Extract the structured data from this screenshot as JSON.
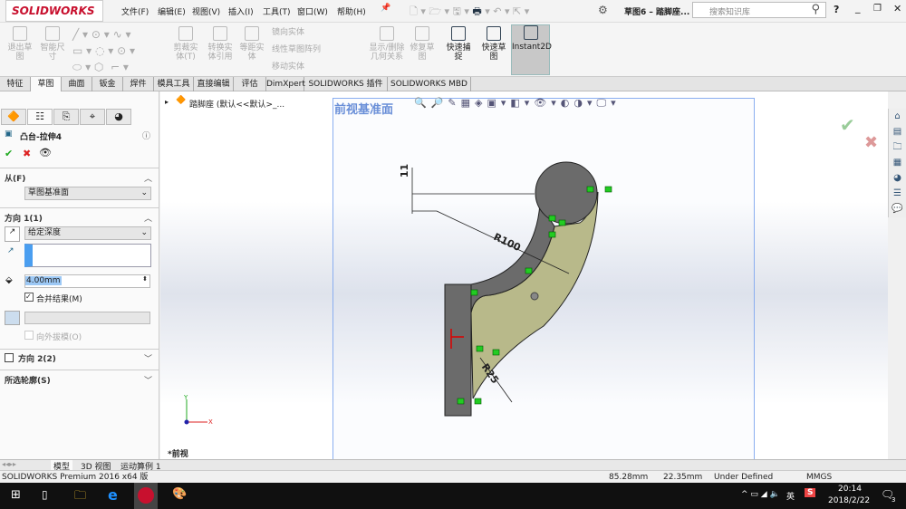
{
  "app": {
    "logo": "SOLIDWORKS",
    "doc_title": "草图6 – 踏脚座...",
    "search_placeholder": "搜索知识库"
  },
  "menu": [
    "文件(F)",
    "编辑(E)",
    "视图(V)",
    "插入(I)",
    "工具(T)",
    "窗口(W)",
    "帮助(H)"
  ],
  "ribbon": [
    {
      "label": "退出草图"
    },
    {
      "label": "智能尺寸"
    },
    {
      "label": "剪裁实体(T)"
    },
    {
      "label": "转换实体引用"
    },
    {
      "label": "等距实体"
    },
    {
      "label": "镜向实体"
    },
    {
      "label": "线性草图阵列"
    },
    {
      "label": "移动实体"
    },
    {
      "label": "显示/删除几何关系"
    },
    {
      "label": "修复草图"
    },
    {
      "label": "快速捕捉"
    },
    {
      "label": "快速草图"
    },
    {
      "label": "Instant2D"
    }
  ],
  "tabs": [
    "特征",
    "草图",
    "曲面",
    "钣金",
    "焊件",
    "模具工具",
    "直接编辑",
    "评估",
    "DimXpert",
    "SOLIDWORKS 插件",
    "SOLIDWORKS MBD"
  ],
  "panel": {
    "title": "凸台-拉伸4",
    "from_label": "从(F)",
    "from_value": "草图基准面",
    "dir1_label": "方向 1(1)",
    "dir1_type": "给定深度",
    "depth": "4.00mm",
    "merge_label": "合并结果(M)",
    "merge_checked": true,
    "draft_label": "向外拔模(O)",
    "dir2_label": "方向 2(2)",
    "contours_label": "所选轮廓(S)"
  },
  "tree": {
    "root": "踏脚座 (默认<<默认>_..."
  },
  "viewport": {
    "view_name": "前视基准面",
    "bottom_label": "*前视",
    "dims": [
      "11",
      "R100",
      "R25"
    ]
  },
  "bottom_tabs": [
    "模型",
    "3D 视图",
    "运动算例 1"
  ],
  "status": {
    "product": "SOLIDWORKS Premium 2016 x64 版",
    "x": "85.28mm",
    "y": "22.35mm",
    "state": "Under Defined",
    "units": "MMGS"
  },
  "taskbar": {
    "lang": "英",
    "time": "20:14",
    "date": "2018/2/22",
    "notif": "3"
  },
  "colors": {
    "accent": "#0078d7",
    "shape_dark": "#6b6b6b",
    "shape_olive": "#b8b98a"
  }
}
